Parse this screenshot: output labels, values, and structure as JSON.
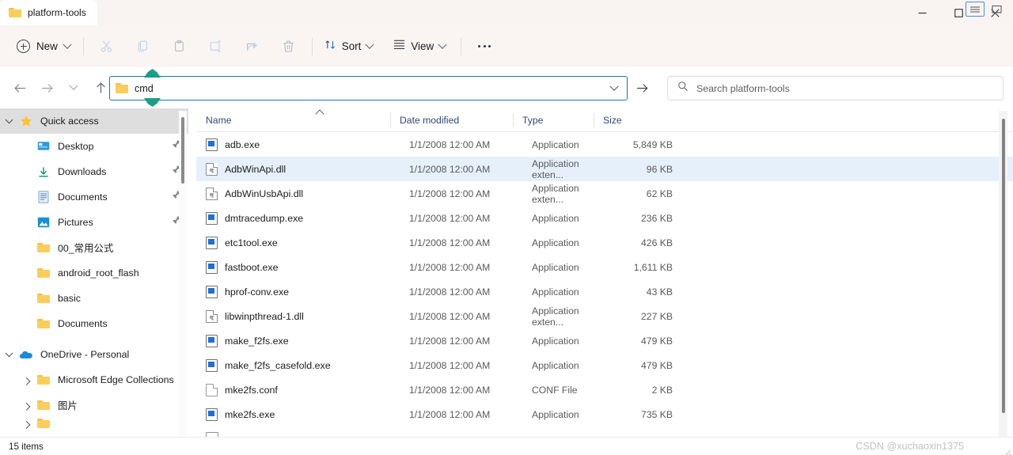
{
  "window": {
    "title": "platform-tools",
    "folder_icon": "folder-icon",
    "controls": {
      "minimize": "minimize-icon",
      "maximize": "maximize-icon",
      "close": "close-icon"
    }
  },
  "toolbar": {
    "new_label": "New",
    "new_icon": "plus-circle-icon",
    "actions": [
      {
        "name": "cut",
        "icon": "scissors-icon"
      },
      {
        "name": "copy",
        "icon": "copy-icon"
      },
      {
        "name": "paste",
        "icon": "paste-icon"
      },
      {
        "name": "rename",
        "icon": "rename-icon"
      },
      {
        "name": "share",
        "icon": "share-icon"
      },
      {
        "name": "delete",
        "icon": "trash-icon"
      }
    ],
    "sort_label": "Sort",
    "sort_icon": "sort-arrows-icon",
    "view_label": "View",
    "view_icon": "list-lines-icon",
    "more_label": "See more",
    "more_icon": "ellipsis-icon"
  },
  "navigation": {
    "back_icon": "arrow-left-icon",
    "forward_icon": "arrow-right-icon",
    "recent_icon": "chevron-down-icon",
    "up_icon": "arrow-up-icon",
    "address": {
      "value": "cmd",
      "folder_icon": "folder-icon",
      "dropdown_icon": "chevron-down-icon",
      "go_icon": "arrow-right-icon",
      "selection_handle_color": "#1a9e86"
    },
    "search": {
      "placeholder": "Search platform-tools",
      "icon": "search-icon"
    }
  },
  "sidebar": {
    "groups": [
      {
        "label": "Quick access",
        "icon": "star-icon",
        "expanded": true,
        "selected": true,
        "items": [
          {
            "label": "Desktop",
            "icon": "desktop-icon",
            "pinned": true
          },
          {
            "label": "Downloads",
            "icon": "download-icon",
            "pinned": true
          },
          {
            "label": "Documents",
            "icon": "document-icon",
            "pinned": true
          },
          {
            "label": "Pictures",
            "icon": "picture-icon",
            "pinned": true
          },
          {
            "label": "00_常用公式",
            "icon": "folder-icon",
            "pinned": false
          },
          {
            "label": "android_root_flash",
            "icon": "folder-icon",
            "pinned": false
          },
          {
            "label": "basic",
            "icon": "folder-icon",
            "pinned": false
          },
          {
            "label": "Documents",
            "icon": "folder-icon",
            "pinned": false
          }
        ]
      },
      {
        "label": "OneDrive - Personal",
        "icon": "cloud-icon",
        "expanded": true,
        "selected": false,
        "items": [
          {
            "label": "Microsoft Edge Collections",
            "icon": "folder-icon",
            "expandable": true
          },
          {
            "label": "图片",
            "icon": "folder-icon",
            "expandable": true
          }
        ]
      }
    ]
  },
  "filelist": {
    "columns": [
      {
        "key": "name",
        "label": "Name",
        "sorted": "asc"
      },
      {
        "key": "date",
        "label": "Date modified"
      },
      {
        "key": "type",
        "label": "Type"
      },
      {
        "key": "size",
        "label": "Size"
      }
    ],
    "rows": [
      {
        "name": "adb.exe",
        "date": "1/1/2008 12:00 AM",
        "type": "Application",
        "size": "5,849 KB",
        "icon": "exe-icon",
        "selected": false
      },
      {
        "name": "AdbWinApi.dll",
        "date": "1/1/2008 12:00 AM",
        "type": "Application exten...",
        "size": "96 KB",
        "icon": "dll-icon",
        "selected": true
      },
      {
        "name": "AdbWinUsbApi.dll",
        "date": "1/1/2008 12:00 AM",
        "type": "Application exten...",
        "size": "62 KB",
        "icon": "dll-icon",
        "selected": false
      },
      {
        "name": "dmtracedump.exe",
        "date": "1/1/2008 12:00 AM",
        "type": "Application",
        "size": "236 KB",
        "icon": "exe-icon",
        "selected": false
      },
      {
        "name": "etc1tool.exe",
        "date": "1/1/2008 12:00 AM",
        "type": "Application",
        "size": "426 KB",
        "icon": "exe-icon",
        "selected": false
      },
      {
        "name": "fastboot.exe",
        "date": "1/1/2008 12:00 AM",
        "type": "Application",
        "size": "1,611 KB",
        "icon": "exe-icon",
        "selected": false
      },
      {
        "name": "hprof-conv.exe",
        "date": "1/1/2008 12:00 AM",
        "type": "Application",
        "size": "43 KB",
        "icon": "exe-icon",
        "selected": false
      },
      {
        "name": "libwinpthread-1.dll",
        "date": "1/1/2008 12:00 AM",
        "type": "Application exten...",
        "size": "227 KB",
        "icon": "dll-icon",
        "selected": false
      },
      {
        "name": "make_f2fs.exe",
        "date": "1/1/2008 12:00 AM",
        "type": "Application",
        "size": "479 KB",
        "icon": "exe-icon",
        "selected": false
      },
      {
        "name": "make_f2fs_casefold.exe",
        "date": "1/1/2008 12:00 AM",
        "type": "Application",
        "size": "479 KB",
        "icon": "exe-icon",
        "selected": false
      },
      {
        "name": "mke2fs.conf",
        "date": "1/1/2008 12:00 AM",
        "type": "CONF File",
        "size": "2 KB",
        "icon": "conf-icon",
        "selected": false
      },
      {
        "name": "mke2fs.exe",
        "date": "1/1/2008 12:00 AM",
        "type": "Application",
        "size": "735 KB",
        "icon": "exe-icon",
        "selected": false
      }
    ]
  },
  "statusbar": {
    "item_count": "15 items",
    "watermark": "CSDN @xuchaoxin1375",
    "views": [
      {
        "name": "details-view",
        "icon": "details-view-icon",
        "active": true
      },
      {
        "name": "large-icons-view",
        "icon": "large-icons-view-icon",
        "active": false
      }
    ]
  }
}
